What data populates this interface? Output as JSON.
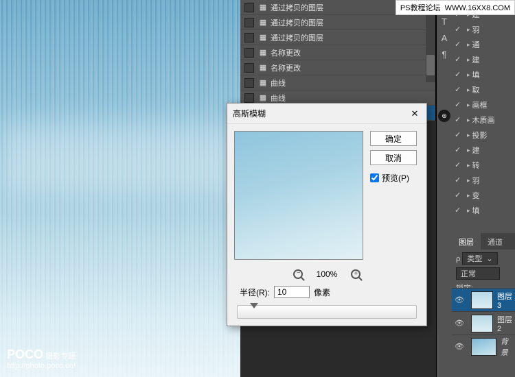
{
  "watermark": {
    "left": "PS教程论坛",
    "right": "WWW.16XX8.COM"
  },
  "logo": {
    "brand": "POCO",
    "tag": "摄影专题",
    "url": "http://photo.poco.cn/"
  },
  "history": [
    {
      "label": "通过拷贝的图层"
    },
    {
      "label": "通过拷贝的图层"
    },
    {
      "label": "通过拷贝的图层"
    },
    {
      "label": "名称更改"
    },
    {
      "label": "名称更改"
    },
    {
      "label": "曲线"
    },
    {
      "label": "曲线"
    }
  ],
  "dialog": {
    "title": "高斯模糊",
    "ok": "确定",
    "cancel": "取消",
    "preview_label": "预览(P)",
    "zoom": "100%",
    "radius_label": "半径(R):",
    "radius_value": "10",
    "unit": "像素"
  },
  "tools": [
    "T",
    "A",
    "¶"
  ],
  "group_layers": [
    {
      "label": "建"
    },
    {
      "label": "羽"
    },
    {
      "label": "通"
    },
    {
      "label": "建"
    },
    {
      "label": "填"
    },
    {
      "label": "取"
    },
    {
      "label": "画框"
    },
    {
      "label": "木质画"
    },
    {
      "label": "投影"
    },
    {
      "label": "建"
    },
    {
      "label": "转"
    },
    {
      "label": "羽"
    },
    {
      "label": "变"
    },
    {
      "label": "填"
    }
  ],
  "panelTabs": {
    "layers": "图层",
    "channels": "通道"
  },
  "layerToolbar": {
    "kind": "类型",
    "blend": "正常",
    "lock": "锁定:"
  },
  "layers": [
    {
      "name": "图层 3"
    },
    {
      "name": "图层 2"
    },
    {
      "name": "背景"
    }
  ]
}
